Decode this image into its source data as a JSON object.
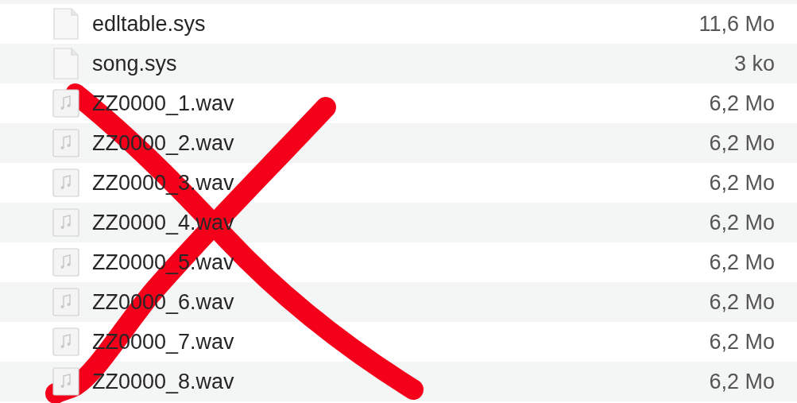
{
  "files": [
    {
      "kind": "document",
      "name": "edltable.sys",
      "size": "11,6 Mo"
    },
    {
      "kind": "document",
      "name": "song.sys",
      "size": "3 ko"
    },
    {
      "kind": "audio",
      "name": "ZZ0000_1.wav",
      "size": "6,2 Mo"
    },
    {
      "kind": "audio",
      "name": "ZZ0000_2.wav",
      "size": "6,2 Mo"
    },
    {
      "kind": "audio",
      "name": "ZZ0000_3.wav",
      "size": "6,2 Mo"
    },
    {
      "kind": "audio",
      "name": "ZZ0000_4.wav",
      "size": "6,2 Mo"
    },
    {
      "kind": "audio",
      "name": "ZZ0000_5.wav",
      "size": "6,2 Mo"
    },
    {
      "kind": "audio",
      "name": "ZZ0000_6.wav",
      "size": "6,2 Mo"
    },
    {
      "kind": "audio",
      "name": "ZZ0000_7.wav",
      "size": "6,2 Mo"
    },
    {
      "kind": "audio",
      "name": "ZZ0000_8.wav",
      "size": "6,2 Mo"
    }
  ]
}
